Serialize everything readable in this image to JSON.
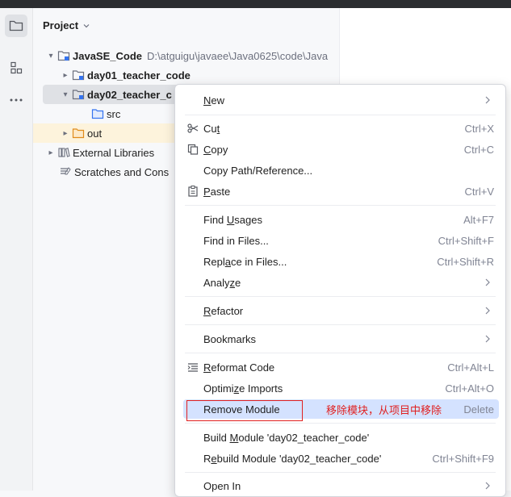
{
  "toolstrip": {
    "items": [
      {
        "icon": "folder-icon",
        "active": true
      },
      {
        "icon": "structure-icon",
        "active": false
      },
      {
        "icon": "more-icon",
        "active": false
      }
    ]
  },
  "panel": {
    "title": "Project"
  },
  "tree": {
    "root_label": "JavaSE_Code",
    "root_path": "D:\\atguigu\\javaee\\Java0625\\code\\Java",
    "day01_label": "day01_teacher_code",
    "day02_label": "day02_teacher_c",
    "src_label": "src",
    "out_label": "out",
    "ext_label": "External Libraries",
    "scratch_label": "Scratches and Cons"
  },
  "menu": {
    "new": {
      "label_u": "N",
      "label_rest": "ew"
    },
    "cut": {
      "label_pre": "Cu",
      "label_u": "t",
      "key": "Ctrl+X"
    },
    "copy": {
      "label_u": "C",
      "label_rest": "opy",
      "key": "Ctrl+C"
    },
    "copy_path": {
      "label": "Copy Path/Reference..."
    },
    "paste": {
      "label_u": "P",
      "label_rest": "aste",
      "key": "Ctrl+V"
    },
    "find_usages": {
      "label_pre": "Find ",
      "label_u": "U",
      "label_rest": "sages",
      "key": "Alt+F7"
    },
    "find_in_files": {
      "label": "Find in Files...",
      "key": "Ctrl+Shift+F"
    },
    "replace": {
      "label_pre": "Repl",
      "label_u": "a",
      "label_rest": "ce in Files...",
      "key": "Ctrl+Shift+R"
    },
    "analyze": {
      "label_pre": "Analy",
      "label_u": "z",
      "label_rest": "e"
    },
    "refactor": {
      "label_u": "R",
      "label_rest": "efactor"
    },
    "bookmarks": {
      "label": "Bookmarks"
    },
    "reformat": {
      "label_u": "R",
      "label_rest": "eformat Code",
      "key": "Ctrl+Alt+L"
    },
    "optimize": {
      "label_pre": "Optimi",
      "label_u": "z",
      "label_rest": "e Imports",
      "key": "Ctrl+Alt+O"
    },
    "remove_module": {
      "label": "Remove Module",
      "key": "Delete",
      "annotation": "移除模块，从项目中移除"
    },
    "build_module": {
      "label_pre": "Build ",
      "label_u": "M",
      "label_rest": "odule 'day02_teacher_code'"
    },
    "rebuild_module": {
      "label_pre": "R",
      "label_u": "e",
      "label_rest": "build Module 'day02_teacher_code'",
      "key": "Ctrl+Shift+F9"
    },
    "open_in": {
      "label": "Open In"
    }
  }
}
